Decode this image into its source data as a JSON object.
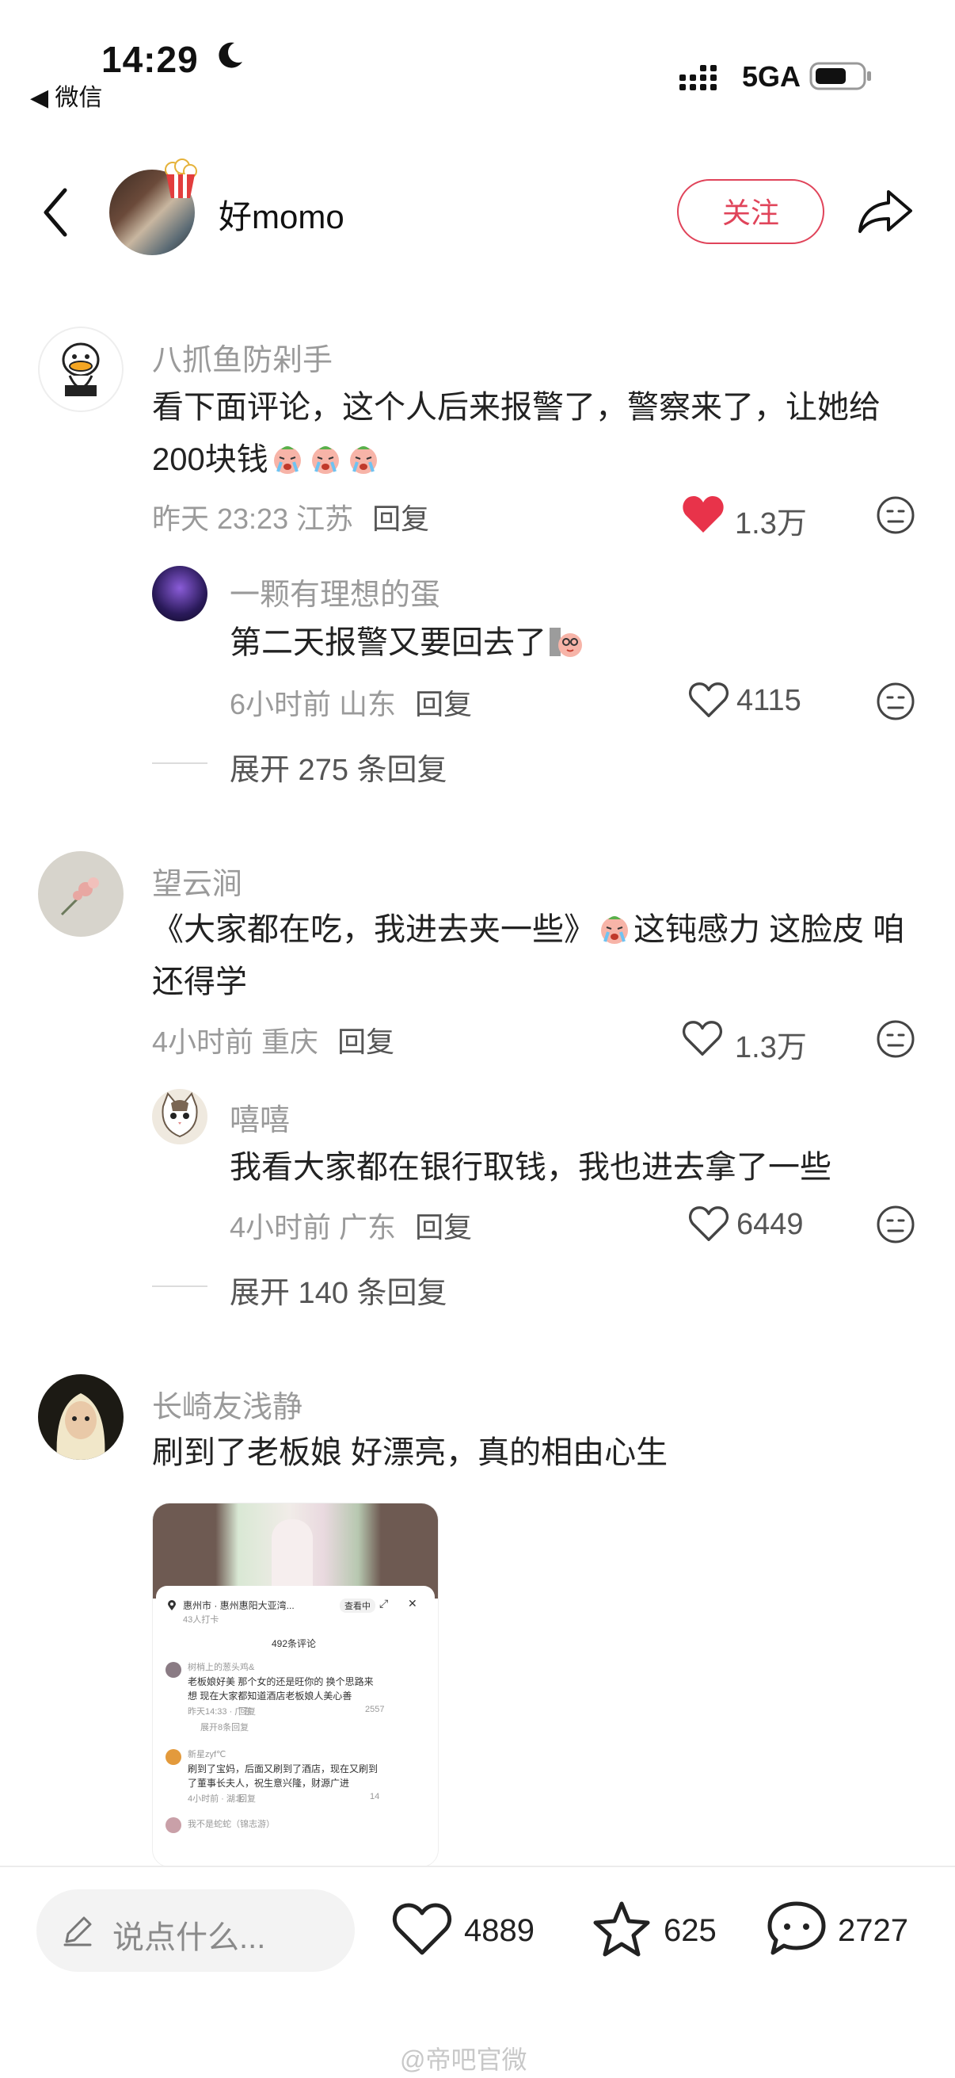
{
  "status_bar": {
    "time": "14:29",
    "back_app": "◀ 微信",
    "network": "5GA"
  },
  "header": {
    "username": "好momo",
    "follow_label": "关注"
  },
  "comments": [
    {
      "user": "八抓鱼防剁手",
      "text_1": "看下面评论，这个人后来报警了，警察来了，让她给",
      "text_2": "200块钱",
      "time": "昨天 23:23",
      "location": "江苏",
      "reply_label": "回复",
      "likes": "1.3万",
      "liked": true,
      "replies": [
        {
          "user": "一颗有理想的蛋",
          "text": "第二天报警又要回去了",
          "time": "6小时前",
          "location": "山东",
          "reply_label": "回复",
          "likes": "4115"
        }
      ],
      "expand_label": "展开 275 条回复"
    },
    {
      "user": "望云涧",
      "text_1": "《大家都在吃，我进去夹一些》",
      "text_1b": "这钝感力 这脸皮 咱",
      "text_2": "还得学",
      "time": "4小时前",
      "location": "重庆",
      "reply_label": "回复",
      "likes": "1.3万",
      "liked": false,
      "replies": [
        {
          "user": "嘻嘻",
          "text": "我看大家都在银行取钱，我也进去拿了一些",
          "time": "4小时前",
          "location": "广东",
          "reply_label": "回复",
          "likes": "6449"
        }
      ],
      "expand_label": "展开 140 条回复"
    },
    {
      "user": "长崎友浅静",
      "text": "刷到了老板娘 好漂亮，真的相由心生"
    }
  ],
  "embedded_screenshot": {
    "location_title": "惠州市 · 惠州惠阳大亚湾...",
    "checkins": "43人打卡",
    "chip": "查看中",
    "comment_count": "492条评论",
    "c1_user": "树梢上的葱头鸡&",
    "c1_text_1": "老板娘好美 那个女的还是旺你的 换个思路来",
    "c1_text_2": "想 现在大家都知道酒店老板娘人美心善",
    "c1_meta": "昨天14:33 · 广东",
    "c1_reply": "回复",
    "c1_likes": "2557",
    "c1_expand": "展开8条回复",
    "c2_user": "新星zyf℃",
    "c2_text_1": "刷到了宝妈，后面又刷到了酒店，现在又刷到",
    "c2_text_2": "了董事长夫人，祝生意兴隆，财源广进",
    "c2_meta": "4小时前 · 湖北",
    "c2_reply": "回复",
    "c2_likes": "14",
    "c3_user": "我不是蛇蛇（锦志游）"
  },
  "bottom_bar": {
    "input_placeholder": "说点什么...",
    "likes": "4889",
    "favorites": "625",
    "comments": "2727"
  },
  "watermark": "@帝吧官微",
  "colors": {
    "accent": "#e0445a",
    "like_red": "#e8334a",
    "meta_gray": "#9a9a9a"
  }
}
